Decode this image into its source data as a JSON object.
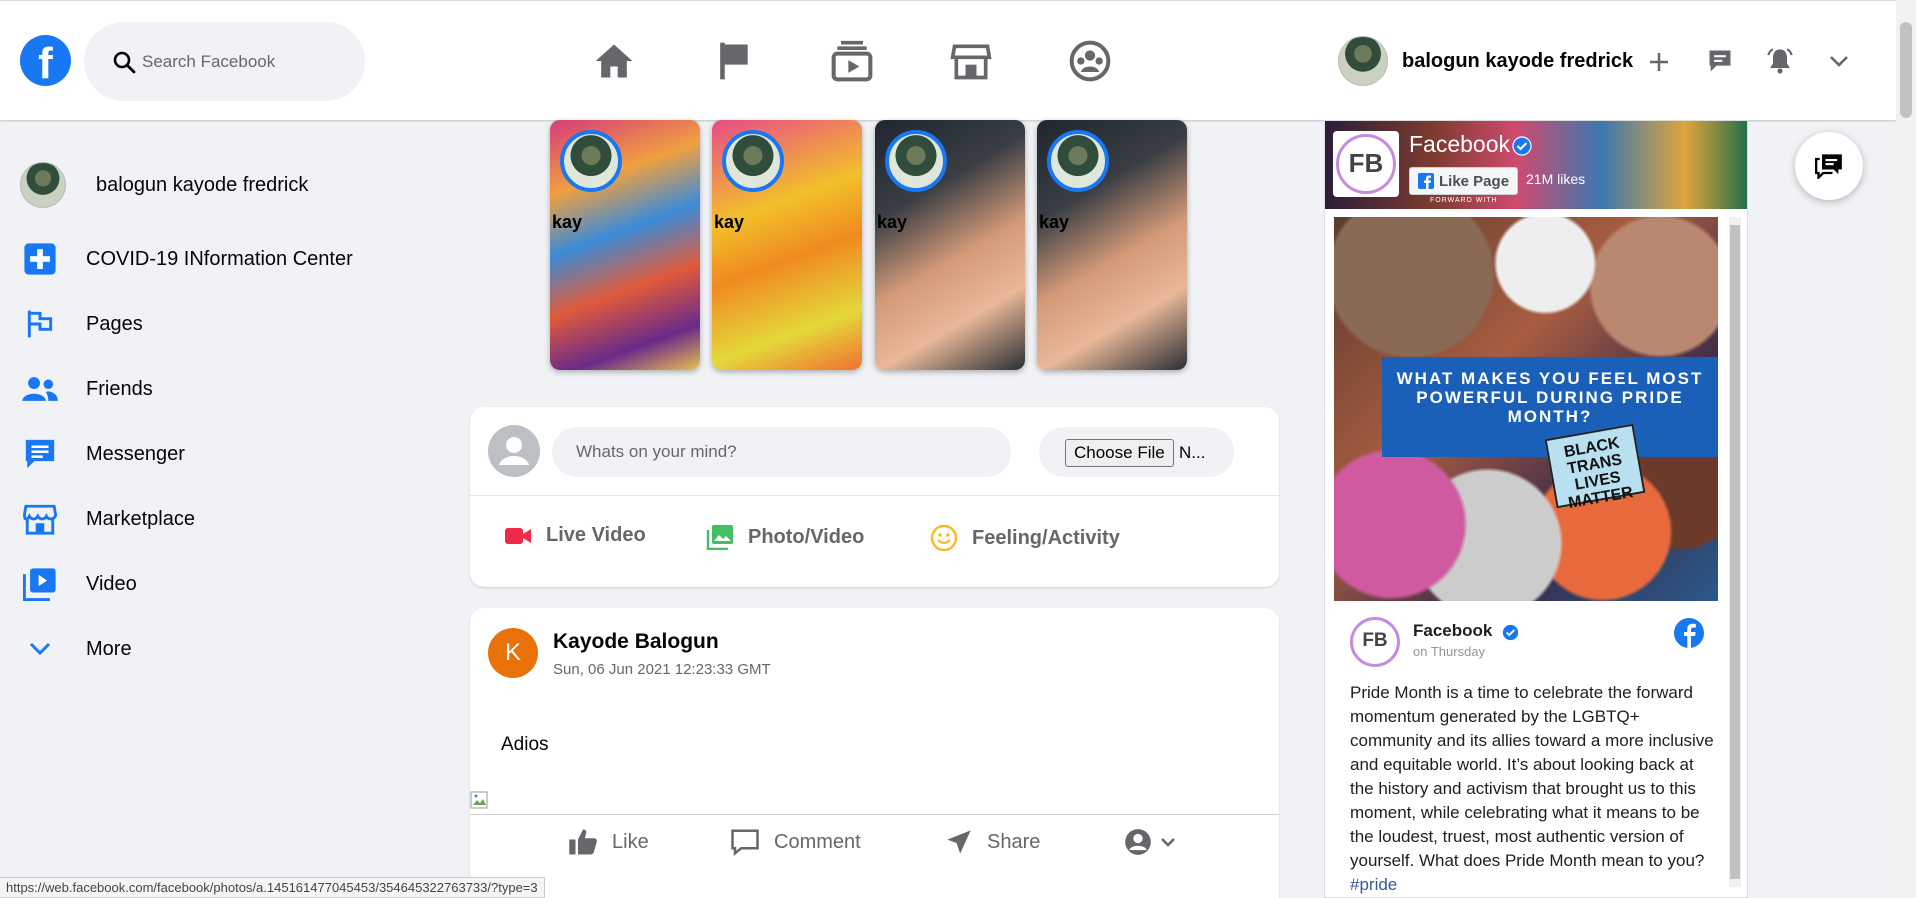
{
  "header": {
    "logo": "f",
    "search_placeholder": "Search Facebook",
    "nav_icons": [
      "home-icon",
      "pages-flag-icon",
      "watch-icon",
      "marketplace-icon",
      "groups-icon"
    ],
    "user_name": "balogun kayode fredrick"
  },
  "sidebar": {
    "profile_name": "balogun kayode fredrick",
    "items": [
      {
        "label": "COVID-19 INformation Center",
        "icon": "covid-plus-icon"
      },
      {
        "label": "Pages",
        "icon": "flag-icon"
      },
      {
        "label": "Friends",
        "icon": "friends-icon"
      },
      {
        "label": "Messenger",
        "icon": "messenger-icon"
      },
      {
        "label": "Marketplace",
        "icon": "store-icon"
      },
      {
        "label": "Video",
        "icon": "video-icon"
      },
      {
        "label": "More",
        "icon": "chevron-down-icon"
      }
    ]
  },
  "stories": [
    {
      "name": "kay"
    },
    {
      "name": "kay"
    },
    {
      "name": "kay"
    },
    {
      "name": "kay"
    }
  ],
  "composer": {
    "placeholder": "Whats on your mind?",
    "choose_file": "Choose File",
    "file_name": "N...",
    "actions": [
      "Live Video",
      "Photo/Video",
      "Feeling/Activity"
    ]
  },
  "post": {
    "avatar_letter": "K",
    "author": "Kayode Balogun",
    "timestamp": "Sun, 06 Jun 2021 12:23:33 GMT",
    "text": "Adios",
    "footer": {
      "like": "Like",
      "comment": "Comment",
      "share": "Share"
    }
  },
  "widget": {
    "page_name": "Facebook",
    "logo_text": "FB",
    "like_button": "Like Page",
    "likes": "21M likes",
    "header_caption": "FORWARD WITH",
    "hero_banner": "WHAT MAKES YOU FEEL MOST POWERFUL DURING PRIDE MONTH?",
    "hero_sign": "BLACK TRANS LIVES MATTER",
    "post_author": "Facebook",
    "post_time": "on Thursday",
    "post_text": "Pride Month is a time to celebrate the forward momentum generated by the LGBTQ+ community and its allies toward a more inclusive and equitable world. It’s about looking back at the history and activism that brought us to this moment, while celebrating what it means to be the loudest, truest, most authentic version of yourself. What does Pride Month mean to you?",
    "hashtag": "#pride"
  },
  "status_url": "https://web.facebook.com/facebook/photos/a.145161477045453/354645322763733/?type=3",
  "colors": {
    "brand_blue": "#1877f2",
    "background": "#f0f2f5",
    "live_red": "#f02849",
    "photo_green": "#45bd62",
    "feeling_yellow": "#f7b928"
  }
}
